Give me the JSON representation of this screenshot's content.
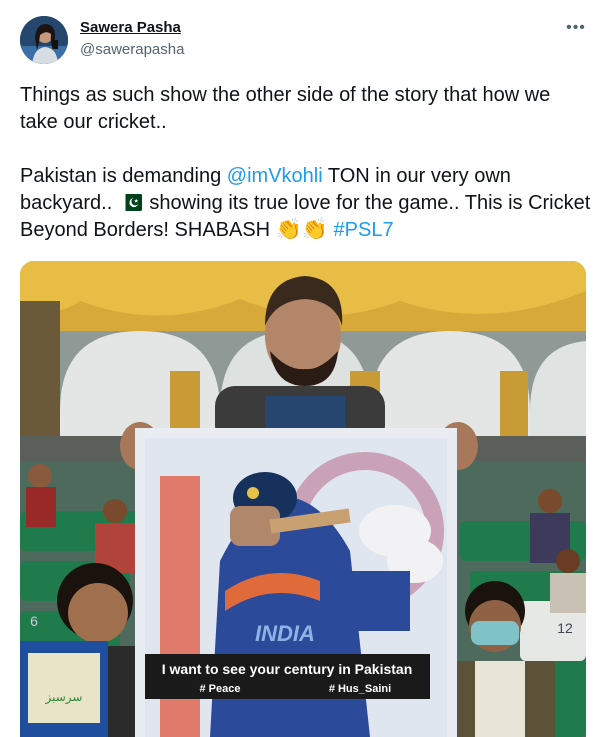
{
  "author": {
    "display_name": "Sawera Pasha",
    "handle": "@sawerapasha",
    "avatar_icon": "profile-photo"
  },
  "more_icon": "ellipsis-icon",
  "tweet": {
    "line1": "Things as such show the other side of the story that how we take our cricket..",
    "p2_before_mention": "Pakistan is demanding ",
    "mention": "@imVkohli",
    "p2_after_mention": " TON in our very own backyard.. ",
    "p2_after_flag": " showing its true love for the game.. This is Cricket Beyond Borders! SHABASH ",
    "claps": "👏👏",
    "hashtag": "#PSL7"
  },
  "media": {
    "poster_caption": "I want to see your century in Pakistan",
    "poster_tag_left": "# Peace",
    "poster_tag_right": "# Hus_Saini",
    "poster_text": "INDIA",
    "seat_number": "12",
    "seat_number_left": "6",
    "banner_text": "سرسبز"
  },
  "colors": {
    "link": "#1d9bf0",
    "text": "#0f1419",
    "secondary": "#536471",
    "stand_yellow": "#e6b535",
    "seat_green": "#1f7a4c",
    "flag_green": "#01411c"
  }
}
